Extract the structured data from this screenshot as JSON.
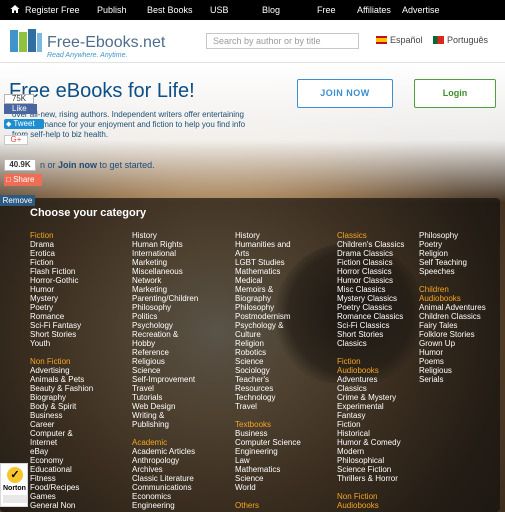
{
  "topnav": {
    "home_icon": "home-icon",
    "items": [
      "Register Free",
      "Publish",
      "Best Books",
      "USB",
      "Blog",
      "Free",
      "Affiliates",
      "Advertise"
    ]
  },
  "header": {
    "logo_name": "Free-Ebooks.net",
    "logo_tagline": "Read Anywhere. Anytime.",
    "search_placeholder": "Search by author or by title",
    "lang_es": "Español",
    "lang_pt": "Português"
  },
  "hero": {
    "title": "Free eBooks for Life!",
    "intro": "over all-new, rising authors. Independent writers offer entertaining fiction/romance for your enjoyment and fiction to help you find info from self-help to biz health.",
    "cta_pre": "n or",
    "cta_link": "Join now",
    "cta_post": "to get started.",
    "join_label": "JOIN NOW",
    "login_label": "Login"
  },
  "social": {
    "fb_count": "75K",
    "fb_like": "Like",
    "tweet": "Tweet",
    "gplus": "G+",
    "share_count": "40.9K",
    "share": "Share",
    "remove": "Remove"
  },
  "panel": {
    "title": "Choose your category",
    "columns": [
      [
        {
          "t": "Fiction",
          "h": true
        },
        {
          "t": "Drama"
        },
        {
          "t": "Erotica"
        },
        {
          "t": "Fiction"
        },
        {
          "t": "Flash Fiction"
        },
        {
          "t": "Horror-Gothic"
        },
        {
          "t": "Humor"
        },
        {
          "t": "Mystery"
        },
        {
          "t": "Poetry"
        },
        {
          "t": "Romance"
        },
        {
          "t": "Sci-Fi Fantasy"
        },
        {
          "t": "Short Stories"
        },
        {
          "t": "Youth"
        },
        {
          "t": "",
          "gap": true
        },
        {
          "t": "Non Fiction",
          "h": true
        },
        {
          "t": "Advertising"
        },
        {
          "t": "Animals & Pets"
        },
        {
          "t": "Beauty & Fashion"
        },
        {
          "t": "Biography"
        },
        {
          "t": "Body & Spirit"
        },
        {
          "t": "Business"
        },
        {
          "t": "Career"
        },
        {
          "t": "Computer &"
        },
        {
          "t": "Internet"
        },
        {
          "t": "eBay"
        },
        {
          "t": "Economy"
        },
        {
          "t": "Educational"
        },
        {
          "t": "Fitness"
        },
        {
          "t": "Food/Recipes"
        },
        {
          "t": "Games"
        },
        {
          "t": "General Non"
        }
      ],
      [
        {
          "t": "History"
        },
        {
          "t": "Human Rights"
        },
        {
          "t": "International"
        },
        {
          "t": "Marketing"
        },
        {
          "t": "Miscellaneous"
        },
        {
          "t": "Network"
        },
        {
          "t": "Marketing"
        },
        {
          "t": "Parenting/Children"
        },
        {
          "t": "Philosophy"
        },
        {
          "t": "Politics"
        },
        {
          "t": "Psychology"
        },
        {
          "t": "Recreation &"
        },
        {
          "t": "Hobby"
        },
        {
          "t": "Reference"
        },
        {
          "t": "Religious"
        },
        {
          "t": "Science"
        },
        {
          "t": "Self-Improvement"
        },
        {
          "t": "Travel"
        },
        {
          "t": "Tutorials"
        },
        {
          "t": "Web Design"
        },
        {
          "t": "Writing &"
        },
        {
          "t": "Publishing"
        },
        {
          "t": "",
          "gap": true
        },
        {
          "t": "Academic",
          "h": true
        },
        {
          "t": "Academic Articles"
        },
        {
          "t": "Anthropology"
        },
        {
          "t": "Archives"
        },
        {
          "t": "Classic Literature"
        },
        {
          "t": "Communications"
        },
        {
          "t": "Economics"
        },
        {
          "t": "Engineering"
        }
      ],
      [
        {
          "t": "History"
        },
        {
          "t": "Humanities and"
        },
        {
          "t": "Arts"
        },
        {
          "t": "LGBT Studies"
        },
        {
          "t": "Mathematics"
        },
        {
          "t": "Medical"
        },
        {
          "t": "Memoirs &"
        },
        {
          "t": "Biography"
        },
        {
          "t": "Philosophy"
        },
        {
          "t": "Postmodernism"
        },
        {
          "t": "Psychology &"
        },
        {
          "t": "Culture"
        },
        {
          "t": "Religion"
        },
        {
          "t": "Robotics"
        },
        {
          "t": "Science"
        },
        {
          "t": "Sociology"
        },
        {
          "t": "Teacher's"
        },
        {
          "t": "Resources"
        },
        {
          "t": "Technology"
        },
        {
          "t": "Travel"
        },
        {
          "t": "",
          "gap": true
        },
        {
          "t": "Textbooks",
          "h": true
        },
        {
          "t": "Business"
        },
        {
          "t": "Computer Science"
        },
        {
          "t": "Engineering"
        },
        {
          "t": "Law"
        },
        {
          "t": "Mathematics"
        },
        {
          "t": "Science"
        },
        {
          "t": "World"
        },
        {
          "t": "",
          "gap": true
        },
        {
          "t": "Others",
          "h": true
        }
      ],
      [
        {
          "t": "Classics",
          "h": true
        },
        {
          "t": "Children's Classics"
        },
        {
          "t": "Drama Classics"
        },
        {
          "t": "Fiction Classics"
        },
        {
          "t": "Horror Classics"
        },
        {
          "t": "Humor Classics"
        },
        {
          "t": "Misc Classics"
        },
        {
          "t": "Mystery Classics"
        },
        {
          "t": "Poetry Classics"
        },
        {
          "t": "Romance Classics"
        },
        {
          "t": "Sci-Fi Classics"
        },
        {
          "t": "Short Stories"
        },
        {
          "t": "Classics"
        },
        {
          "t": "",
          "gap": true
        },
        {
          "t": "Fiction",
          "h": true
        },
        {
          "t": "Audiobooks",
          "h": true
        },
        {
          "t": "Adventures"
        },
        {
          "t": "Classics"
        },
        {
          "t": "Crime & Mystery"
        },
        {
          "t": "Experimental"
        },
        {
          "t": "Fantasy"
        },
        {
          "t": "Fiction"
        },
        {
          "t": "Historical"
        },
        {
          "t": "Humor & Comedy"
        },
        {
          "t": "Modern"
        },
        {
          "t": "Philosophical"
        },
        {
          "t": "Science Fiction"
        },
        {
          "t": "Thrillers & Horror"
        },
        {
          "t": "",
          "gap": true
        },
        {
          "t": "Non Fiction",
          "h": true
        },
        {
          "t": "Audiobooks",
          "h": true
        }
      ],
      [
        {
          "t": "Philosophy"
        },
        {
          "t": "Poetry"
        },
        {
          "t": "Religion"
        },
        {
          "t": "Self Teaching"
        },
        {
          "t": "Speeches"
        },
        {
          "t": "",
          "gap": true
        },
        {
          "t": "Children",
          "h": true
        },
        {
          "t": "Audiobooks",
          "h": true
        },
        {
          "t": "Animal Adventures"
        },
        {
          "t": "Children Classics"
        },
        {
          "t": "Fairy Tales"
        },
        {
          "t": "Folklore Stories"
        },
        {
          "t": "Grown Up"
        },
        {
          "t": "Humor"
        },
        {
          "t": "Poems"
        },
        {
          "t": "Religious"
        },
        {
          "t": "Serials"
        }
      ]
    ]
  },
  "norton": {
    "name": "Norton",
    "icon": "checkmark-icon"
  },
  "colors": {
    "nav_bg": "#000000",
    "accent_orange": "#f5a623",
    "join_blue": "#3b8fd0",
    "login_green": "#4ea03f",
    "title_blue": "#0c4f86"
  }
}
